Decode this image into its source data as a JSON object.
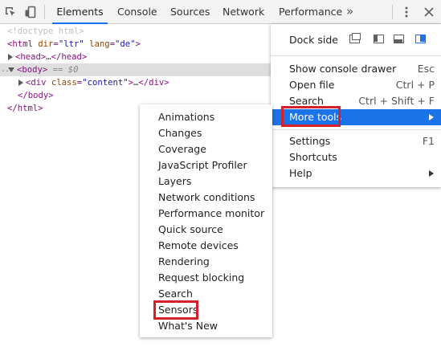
{
  "toolbar": {
    "icons": [
      "inspect-element-icon",
      "device-toolbar-icon",
      "more-tabs-chevron",
      "kebab-menu-icon",
      "close-icon"
    ],
    "tabs": [
      {
        "label": "Elements",
        "active": true
      },
      {
        "label": "Console",
        "active": false
      },
      {
        "label": "Sources",
        "active": false
      },
      {
        "label": "Network",
        "active": false
      },
      {
        "label": "Performance",
        "active": false
      }
    ],
    "more_tabs_symbol": "»",
    "accent": "#1a73e8"
  },
  "dom": {
    "doctype": "<!doctype html>",
    "html_open_tag": "<html",
    "html_dir_attr": "dir",
    "html_dir_val": "\"ltr\"",
    "html_lang_attr": "lang",
    "html_lang_val": "\"de\"",
    "html_close_bracket": ">",
    "head_open": "<head>",
    "head_ellipsis": "…",
    "head_close": "</head>",
    "body_open": "<body>",
    "body_eq": "== $0",
    "body_dots": "...",
    "div_open_tag": "<div",
    "div_class_attr": "class",
    "div_class_val": "\"content\"",
    "div_close_bracket": ">",
    "div_ellipsis": "…",
    "div_close": "</div>",
    "body_close": "</body>",
    "html_close": "</html>"
  },
  "main_menu": {
    "dock_side_label": "Dock side",
    "dock_icons": [
      "undock-icon",
      "dock-left-icon",
      "dock-bottom-icon",
      "dock-right-icon"
    ],
    "items": [
      {
        "label": "Show console drawer",
        "shortcut": "Esc"
      },
      {
        "label": "Open file",
        "shortcut": "Ctrl + P"
      },
      {
        "label": "Search",
        "shortcut": "Ctrl + Shift + F"
      },
      {
        "label": "More tools",
        "shortcut": "",
        "highlighted": true,
        "submenu": true
      },
      {
        "label": "Settings",
        "shortcut": "F1"
      },
      {
        "label": "Shortcuts",
        "shortcut": ""
      },
      {
        "label": "Help",
        "shortcut": "",
        "submenu": true
      }
    ]
  },
  "submenu": {
    "items": [
      "Animations",
      "Changes",
      "Coverage",
      "JavaScript Profiler",
      "Layers",
      "Network conditions",
      "Performance monitor",
      "Quick source",
      "Remote devices",
      "Rendering",
      "Request blocking",
      "Search",
      "Sensors",
      "What's New"
    ]
  },
  "highlight_color": "#d32029"
}
